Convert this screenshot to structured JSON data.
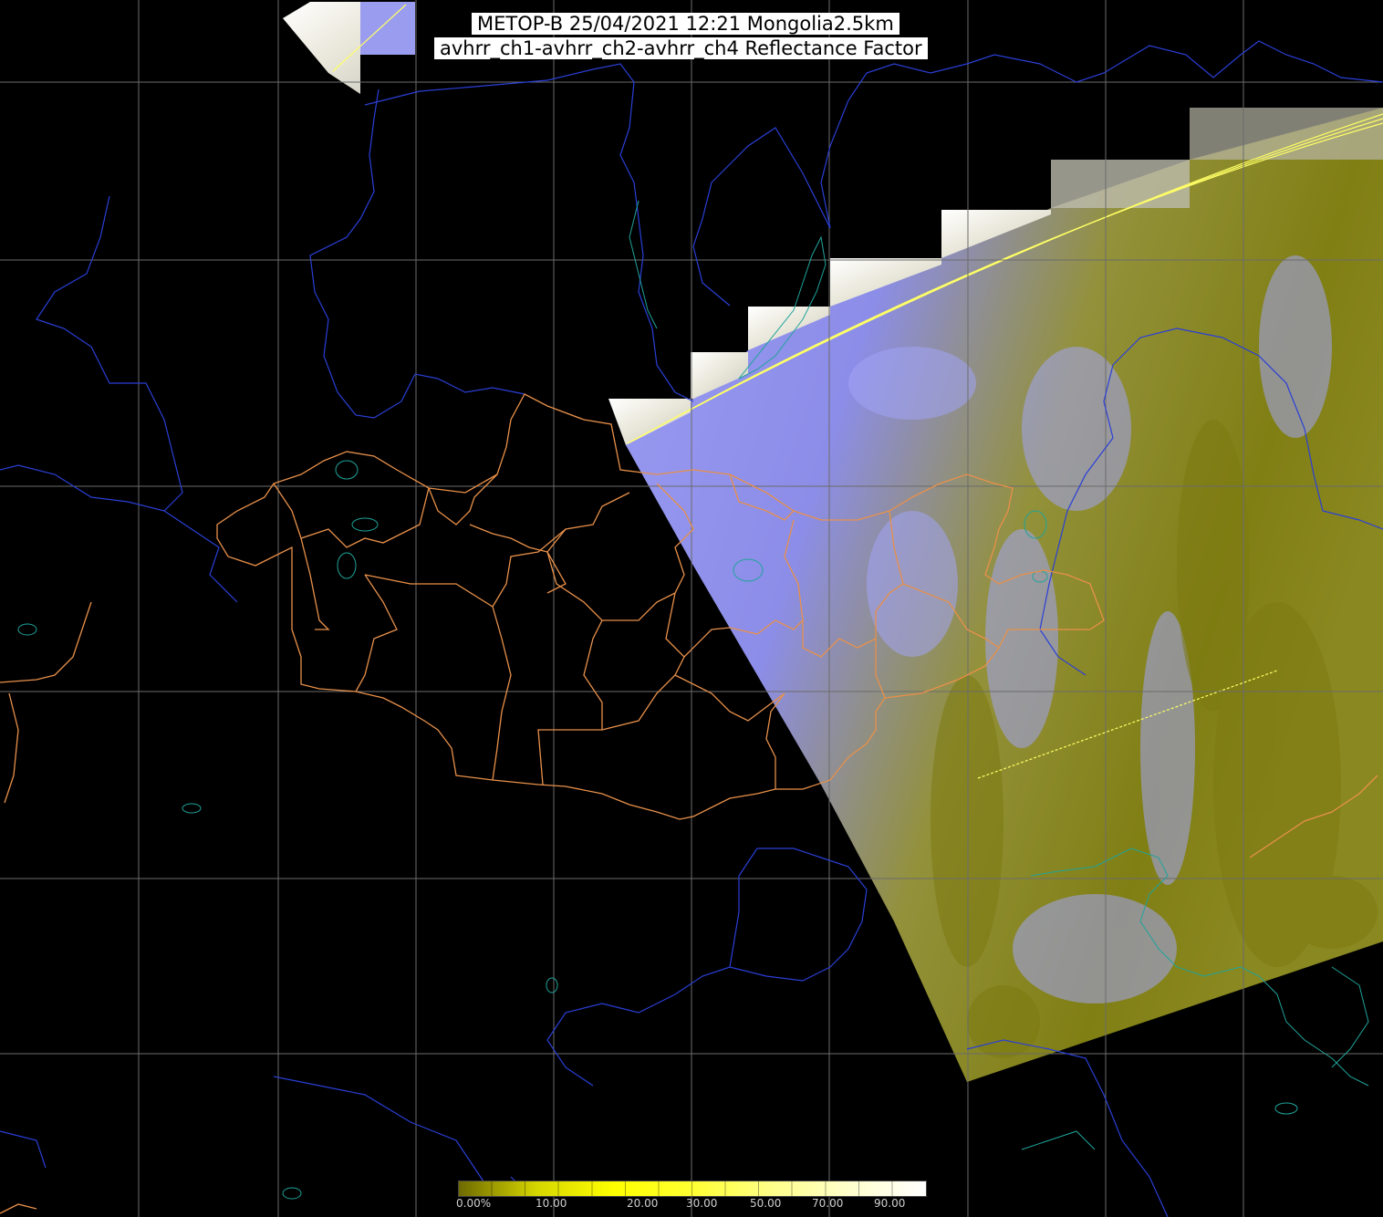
{
  "title": {
    "line1": "METOP-B 25/04/2021 12:21 Mongolia2.5km",
    "line2": "avhrr_ch1-avhrr_ch2-avhrr_ch4 Reflectance Factor"
  },
  "colorbar": {
    "labels": [
      "0.00%",
      "10.00",
      "20.00",
      "30.00",
      "50.00",
      "70.00",
      "90.00"
    ],
    "stops": [
      "#6e6a00",
      "#d6d600",
      "#ffff00",
      "#ffff33",
      "#ffff88",
      "#ffffcc",
      "#ffffff"
    ]
  },
  "colors": {
    "background": "#000000",
    "graticule": "#6b6b6b",
    "rivers": "#2a3fd6",
    "lakes_coast": "#1fa39a",
    "admin_borders": "#e8904a",
    "swath_cloud": "#8f90f0",
    "swath_land": "#8a8a20",
    "scan_line": "#ffff66"
  },
  "map": {
    "projection": "polar stereographic",
    "layers": [
      "graticule",
      "rivers",
      "lakes",
      "admin-borders",
      "satellite-swath",
      "colorbar"
    ]
  }
}
